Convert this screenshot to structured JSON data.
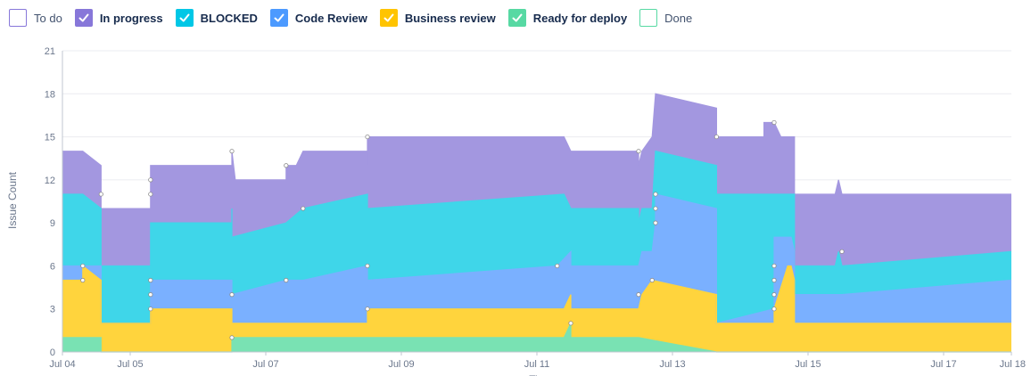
{
  "legend": [
    {
      "name": "To do",
      "color": "#ffffff",
      "border": "#8777d9",
      "checked": false,
      "bold": false
    },
    {
      "name": "In progress",
      "color": "#8777d9",
      "checked": true,
      "bold": true
    },
    {
      "name": "BLOCKED",
      "color": "#00c7e6",
      "checked": true,
      "bold": true
    },
    {
      "name": "Code Review",
      "color": "#4c9aff",
      "checked": true,
      "bold": true
    },
    {
      "name": "Business review",
      "color": "#ffc400",
      "checked": true,
      "bold": true
    },
    {
      "name": "Ready for deploy",
      "color": "#57d9a3",
      "checked": true,
      "bold": true
    },
    {
      "name": "Done",
      "color": "#ffffff",
      "border": "#57d9a3",
      "checked": false,
      "bold": false
    }
  ],
  "chart_data": {
    "type": "area",
    "stacked": true,
    "ylabel": "Issue Count",
    "xlabel": "Ti",
    "ylim": [
      0,
      21
    ],
    "yticks": [
      0,
      3,
      6,
      9,
      12,
      15,
      18,
      21
    ],
    "xlim": [
      0,
      14
    ],
    "xticks": [
      {
        "x": 0,
        "label": "Jul 04"
      },
      {
        "x": 1,
        "label": "Jul 05"
      },
      {
        "x": 3,
        "label": "Jul 07"
      },
      {
        "x": 5,
        "label": "Jul 09"
      },
      {
        "x": 7,
        "label": "Jul 11"
      },
      {
        "x": 9,
        "label": "Jul 13"
      },
      {
        "x": 11,
        "label": "Jul 15"
      },
      {
        "x": 13,
        "label": "Jul 17"
      },
      {
        "x": 14,
        "label": "Jul 18"
      }
    ],
    "x_unit": "days since Jul 04",
    "grid": true,
    "series": [
      {
        "name": "Ready for deploy",
        "color": "#79e2b3",
        "points": [
          [
            0,
            1
          ],
          [
            0.57,
            1
          ],
          [
            0.57,
            0
          ],
          [
            2.5,
            0
          ],
          [
            2.5,
            1
          ],
          [
            7.4,
            1
          ],
          [
            7.5,
            2
          ],
          [
            7.5,
            1
          ],
          [
            8.5,
            1
          ],
          [
            9.65,
            0
          ],
          [
            14,
            0
          ]
        ]
      },
      {
        "name": "Business review",
        "color": "#ffd43d",
        "points": [
          [
            0,
            5
          ],
          [
            0.3,
            5
          ],
          [
            0.3,
            6
          ],
          [
            0.57,
            5
          ],
          [
            0.57,
            2
          ],
          [
            1.3,
            2
          ],
          [
            1.3,
            3
          ],
          [
            2.5,
            3
          ],
          [
            2.5,
            2
          ],
          [
            4.5,
            2
          ],
          [
            4.5,
            3
          ],
          [
            7.4,
            3
          ],
          [
            7.5,
            4
          ],
          [
            7.5,
            3
          ],
          [
            8.5,
            3
          ],
          [
            8.55,
            4
          ],
          [
            8.7,
            5
          ],
          [
            9.65,
            4
          ],
          [
            9.65,
            2
          ],
          [
            10.5,
            2
          ],
          [
            10.5,
            3
          ],
          [
            10.7,
            6
          ],
          [
            10.75,
            6
          ],
          [
            10.8,
            5
          ],
          [
            10.8,
            2
          ],
          [
            14,
            2
          ]
        ]
      },
      {
        "name": "Code Review",
        "color": "#7ab0ff",
        "points": [
          [
            0,
            6
          ],
          [
            0.3,
            6
          ],
          [
            0.57,
            6
          ],
          [
            0.57,
            2
          ],
          [
            1.3,
            2
          ],
          [
            1.3,
            5
          ],
          [
            2.5,
            5
          ],
          [
            2.5,
            4
          ],
          [
            3.3,
            5
          ],
          [
            3.55,
            5
          ],
          [
            4.5,
            6
          ],
          [
            4.5,
            5
          ],
          [
            7.3,
            6
          ],
          [
            7.5,
            7
          ],
          [
            7.5,
            6
          ],
          [
            8.5,
            6
          ],
          [
            8.55,
            7
          ],
          [
            8.7,
            7
          ],
          [
            8.75,
            9
          ],
          [
            8.75,
            11
          ],
          [
            9.65,
            10
          ],
          [
            9.65,
            2
          ],
          [
            10.5,
            3
          ],
          [
            10.5,
            8
          ],
          [
            10.75,
            8
          ],
          [
            10.8,
            7
          ],
          [
            10.8,
            4
          ],
          [
            11.5,
            4
          ],
          [
            14,
            5
          ]
        ]
      },
      {
        "name": "BLOCKED",
        "color": "#3fd6e9",
        "points": [
          [
            0,
            11
          ],
          [
            0.3,
            11
          ],
          [
            0.57,
            10
          ],
          [
            0.57,
            6
          ],
          [
            1.3,
            6
          ],
          [
            1.3,
            9
          ],
          [
            2.5,
            9
          ],
          [
            2.5,
            10
          ],
          [
            2.5,
            8
          ],
          [
            3.3,
            9
          ],
          [
            3.55,
            10
          ],
          [
            4.5,
            11
          ],
          [
            4.5,
            10
          ],
          [
            7.4,
            11
          ],
          [
            7.5,
            10
          ],
          [
            8.5,
            10
          ],
          [
            8.5,
            9
          ],
          [
            8.55,
            10
          ],
          [
            8.7,
            10
          ],
          [
            8.75,
            14
          ],
          [
            9.65,
            13
          ],
          [
            9.65,
            11
          ],
          [
            10.8,
            11
          ],
          [
            10.8,
            10
          ],
          [
            10.8,
            6
          ],
          [
            11.4,
            6
          ],
          [
            11.45,
            7
          ],
          [
            11.5,
            6
          ],
          [
            14,
            7
          ]
        ]
      },
      {
        "name": "In progress",
        "color": "#a397e0",
        "points": [
          [
            0,
            14
          ],
          [
            0.3,
            14
          ],
          [
            0.57,
            13
          ],
          [
            0.57,
            10
          ],
          [
            1.3,
            10
          ],
          [
            1.3,
            12
          ],
          [
            1.3,
            13
          ],
          [
            2.5,
            13
          ],
          [
            2.5,
            14
          ],
          [
            2.55,
            12
          ],
          [
            3.3,
            12
          ],
          [
            3.3,
            13
          ],
          [
            3.45,
            13
          ],
          [
            3.55,
            14
          ],
          [
            4.5,
            14
          ],
          [
            4.5,
            13
          ],
          [
            4.5,
            15
          ],
          [
            7.4,
            15
          ],
          [
            7.5,
            14
          ],
          [
            8.5,
            14
          ],
          [
            8.5,
            13
          ],
          [
            8.55,
            14
          ],
          [
            8.7,
            15
          ],
          [
            8.75,
            18
          ],
          [
            9.65,
            17
          ],
          [
            9.65,
            15
          ],
          [
            10.35,
            15
          ],
          [
            10.35,
            16
          ],
          [
            10.5,
            16
          ],
          [
            10.6,
            15
          ],
          [
            10.8,
            15
          ],
          [
            10.8,
            11
          ],
          [
            11.4,
            11
          ],
          [
            11.45,
            12
          ],
          [
            11.5,
            11
          ],
          [
            14,
            11
          ]
        ]
      }
    ],
    "markers": [
      [
        0.3,
        6
      ],
      [
        0.3,
        5
      ],
      [
        0.57,
        11
      ],
      [
        1.3,
        12
      ],
      [
        1.3,
        11
      ],
      [
        1.3,
        5
      ],
      [
        1.3,
        4
      ],
      [
        1.3,
        3
      ],
      [
        2.5,
        14
      ],
      [
        2.5,
        4
      ],
      [
        2.5,
        1
      ],
      [
        3.3,
        13
      ],
      [
        3.3,
        5
      ],
      [
        3.55,
        10
      ],
      [
        4.5,
        15
      ],
      [
        4.5,
        6
      ],
      [
        4.5,
        3
      ],
      [
        7.3,
        6
      ],
      [
        7.5,
        2
      ],
      [
        8.5,
        14
      ],
      [
        8.5,
        4
      ],
      [
        8.7,
        5
      ],
      [
        8.75,
        11
      ],
      [
        8.75,
        10
      ],
      [
        8.75,
        9
      ],
      [
        9.65,
        15
      ],
      [
        10.5,
        16
      ],
      [
        10.5,
        6
      ],
      [
        10.5,
        5
      ],
      [
        10.5,
        4
      ],
      [
        10.5,
        3
      ],
      [
        11.5,
        7
      ]
    ]
  }
}
